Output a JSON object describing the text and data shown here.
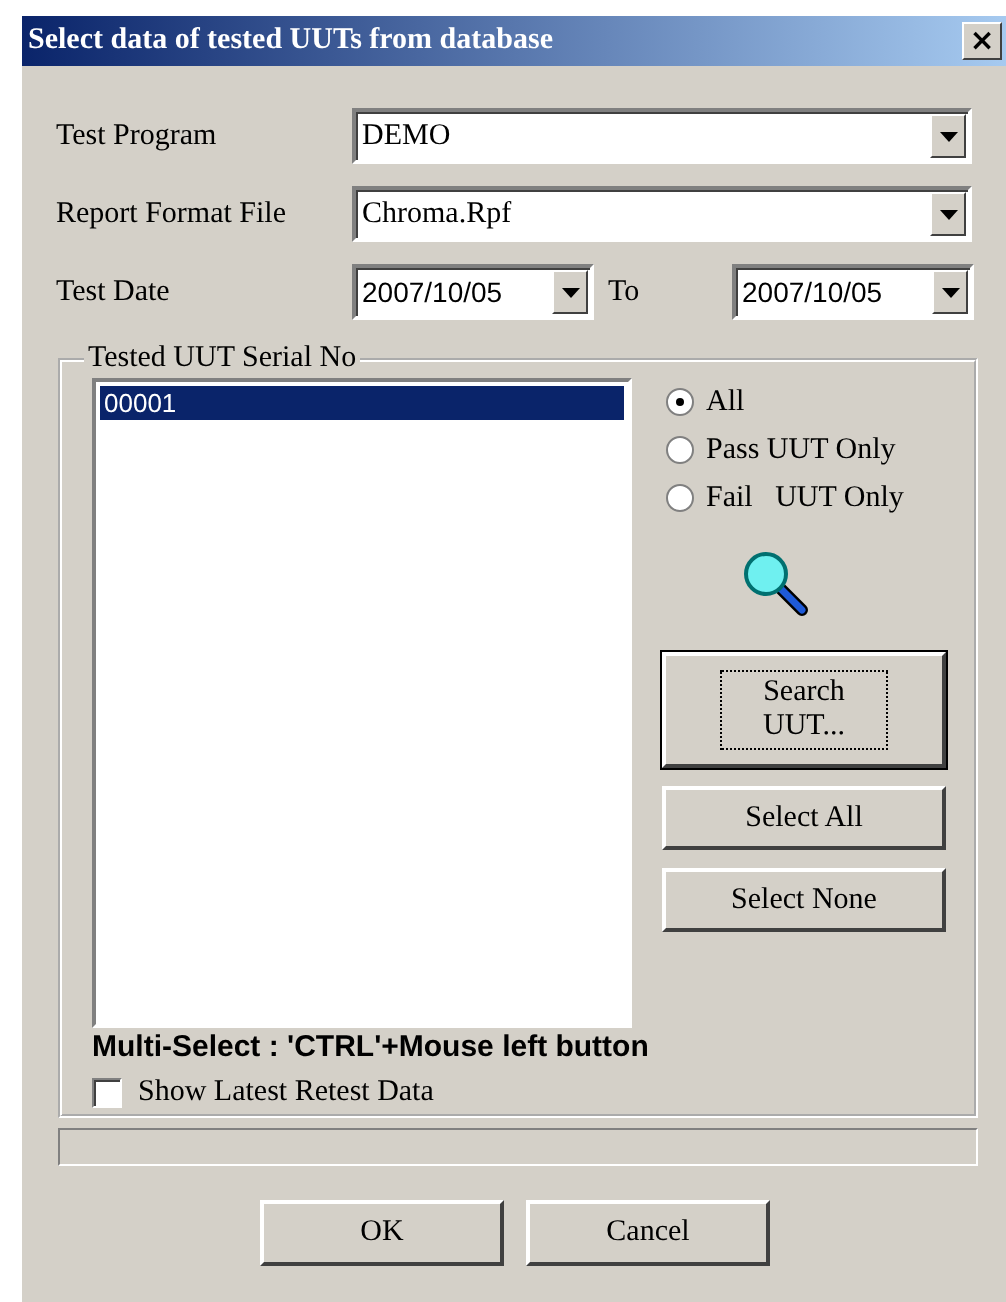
{
  "window": {
    "title": "Select data of tested UUTs from database",
    "close": "×"
  },
  "fields": [
    {
      "label": "Test Program",
      "value": "DEMO"
    },
    {
      "label": "Report Format File",
      "value": "Chroma.Rpf"
    }
  ],
  "test_date": {
    "label": "Test Date",
    "from": "2007/10/05",
    "to_label": "To",
    "to": "2007/10/05"
  },
  "serial_group": {
    "title": "Tested UUT Serial No",
    "items": [
      {
        "text": "00001",
        "selected": true
      }
    ],
    "filters": [
      {
        "label": "All",
        "selected": true
      },
      {
        "label": "Pass UUT Only",
        "selected": false
      },
      {
        "label": "Fail   UUT Only",
        "selected": false
      }
    ],
    "buttons": [
      {
        "label": "Search UUT...",
        "focused": true
      },
      {
        "label": "Select All",
        "focused": false
      },
      {
        "label": "Select None",
        "focused": false
      }
    ],
    "hint": "Multi-Select : 'CTRL'+Mouse left button",
    "retest": {
      "label": "Show Latest Retest Data",
      "checked": false
    }
  },
  "progress": {
    "level": 0
  },
  "buttons": [
    "OK",
    "Cancel"
  ]
}
